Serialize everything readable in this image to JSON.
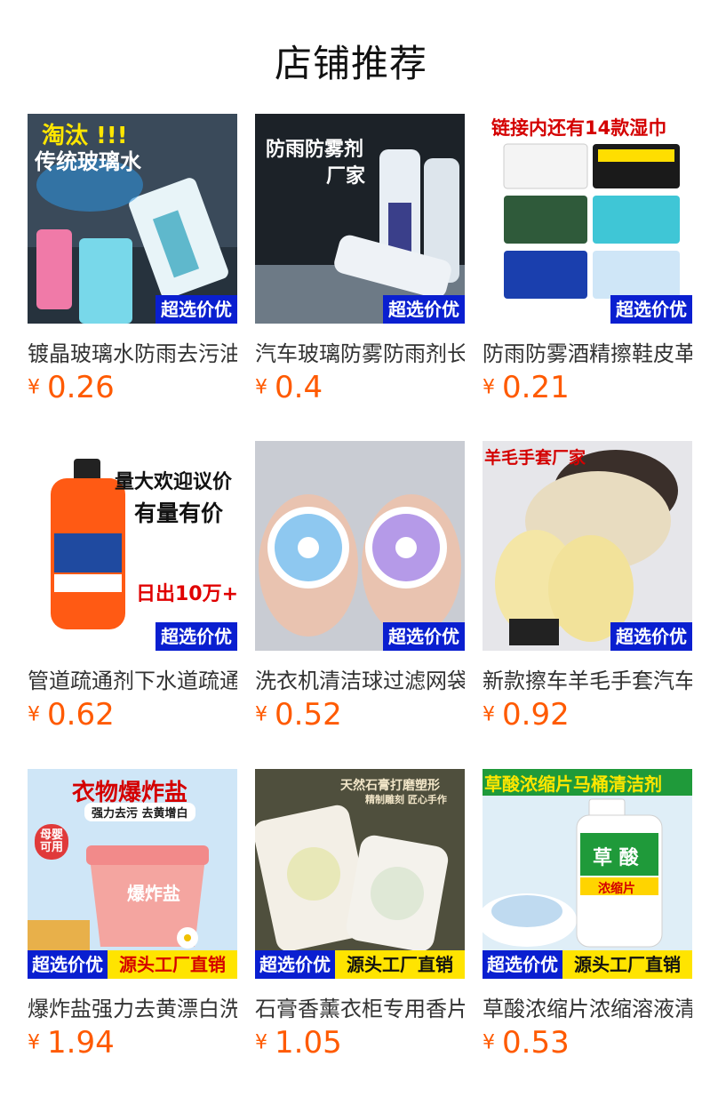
{
  "section": {
    "title": "店铺推荐"
  },
  "products": [
    {
      "title": "镀晶玻璃水防雨去污油膜",
      "currency": "¥",
      "price": "0.26",
      "badge": "超选价优",
      "overlay": [
        "淘汰 !!!",
        "传统玻璃水"
      ],
      "colors": {
        "bg": "#3a4a5a",
        "accent": "#5fd0e8"
      }
    },
    {
      "title": "汽车玻璃防雾防雨剂长效",
      "currency": "¥",
      "price": "0.4",
      "badge": "超选价优",
      "overlay": [
        "防雨防雾剂",
        "厂家"
      ],
      "colors": {
        "bg": "#1c2228",
        "accent": "#e8eef4"
      }
    },
    {
      "title": "防雨防雾酒精擦鞋皮革湿巾",
      "currency": "¥",
      "price": "0.21",
      "badge": "超选价优",
      "overlay": [
        "链接内还有14款湿巾"
      ],
      "colors": {
        "bg": "#ffffff",
        "accent": "#d40000"
      }
    },
    {
      "title": "管道疏通剂下水道疏通强力",
      "currency": "¥",
      "price": "0.62",
      "badge": "超选价优",
      "overlay": [
        "量大欢迎议价",
        "有量有价",
        "日出10万+"
      ],
      "colors": {
        "bg": "#ffffff",
        "accent": "#ff5a14"
      }
    },
    {
      "title": "洗衣机清洁球过滤网袋除毛",
      "currency": "¥",
      "price": "0.52",
      "badge": "超选价优",
      "overlay": [],
      "colors": {
        "bg": "#c9ccd3",
        "accent": "#8ec8f0"
      }
    },
    {
      "title": "新款擦车羊毛手套汽车清洁",
      "currency": "¥",
      "price": "0.92",
      "badge": "超选价优",
      "overlay": [
        "羊毛手套厂家"
      ],
      "colors": {
        "bg": "#e6e6ea",
        "accent": "#f4e6a6"
      }
    },
    {
      "title": "爆炸盐强力去黄漂白洗衣",
      "currency": "¥",
      "price": "1.94",
      "badge": "超选价优",
      "badge2": "源头工厂直销",
      "overlay": [
        "衣物爆炸盐",
        "强力去污 去黄增白",
        "母婴可用",
        "爆炸盐"
      ],
      "colors": {
        "bg": "#cfe6f7",
        "accent": "#f28a8a"
      }
    },
    {
      "title": "石膏香薰衣柜专用香片挂件",
      "currency": "¥",
      "price": "1.05",
      "badge": "超选价优",
      "badge2": "源头工厂直销",
      "overlay": [
        "天然石膏打磨塑形",
        "精制雕刻 匠心手作"
      ],
      "colors": {
        "bg": "#5a4a36",
        "accent": "#f3efe6"
      }
    },
    {
      "title": "草酸浓缩片浓缩溶液清洁剂",
      "currency": "¥",
      "price": "0.53",
      "badge": "超选价优",
      "badge2": "源头工厂直销",
      "overlay": [
        "草酸浓缩片马桶清洁剂",
        "草 酸",
        "浓缩片"
      ],
      "colors": {
        "bg": "#dfeef7",
        "accent": "#1f9a3a"
      }
    }
  ]
}
